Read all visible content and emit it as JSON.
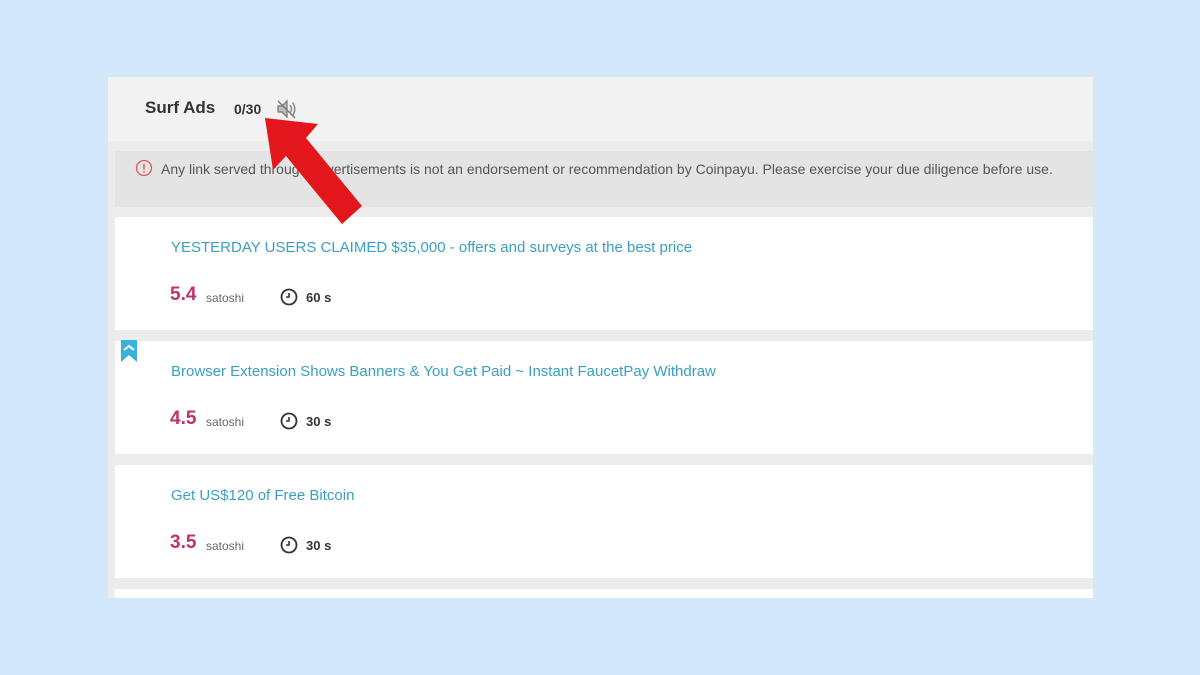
{
  "header": {
    "title": "Surf Ads",
    "counter": "0/30",
    "mute_icon": "speaker-muted-icon"
  },
  "notice": {
    "icon": "info-circle-icon",
    "text": "Any link served through advertisements is not an endorsement or recommendation by Coinpayu. Please exercise your due diligence before use."
  },
  "ads": [
    {
      "title": "YESTERDAY USERS CLAIMED $35,000 - offers and surveys at the best price",
      "reward": "5.4",
      "unit": "satoshi",
      "time": "60 s"
    },
    {
      "title": "Browser Extension Shows Banners & You Get Paid ~ Instant FaucetPay Withdraw",
      "reward": "4.5",
      "unit": "satoshi",
      "time": "30 s"
    },
    {
      "title": "Get US$120 of Free Bitcoin",
      "reward": "3.5",
      "unit": "satoshi",
      "time": "30 s"
    }
  ],
  "colors": {
    "background": "#d4e8fb",
    "link": "#3a9fc0",
    "reward": "#c0326a",
    "arrow": "#e3171b",
    "bookmark": "#3ab0dd"
  },
  "annotation": {
    "icon": "red-pointer-arrow"
  }
}
